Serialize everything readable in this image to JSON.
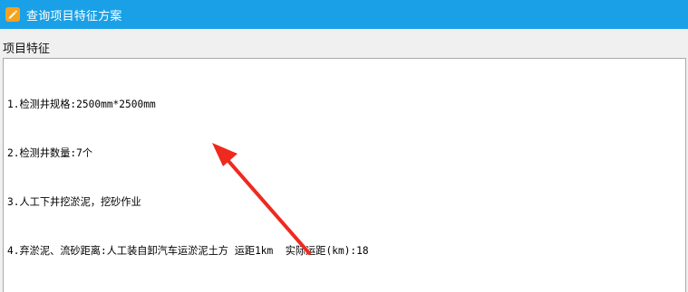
{
  "window": {
    "title": "查询项目特征方案",
    "icon": "pencil-edit-icon",
    "accent_color": "#1aa0e6"
  },
  "section": {
    "label": "项目特征"
  },
  "editor": {
    "lines": [
      "1.检测井规格:2500mm*2500mm",
      "2.检测井数量:7个",
      "3.人工下井挖淤泥，挖砂作业",
      "4.弃淤泥、流砂距离:人工装自卸汽车运淤泥土方 运距1km  实际运距(km):18"
    ]
  },
  "annotation": {
    "arrow_color": "#ee2a1f",
    "icon": "red-arrow-icon"
  }
}
